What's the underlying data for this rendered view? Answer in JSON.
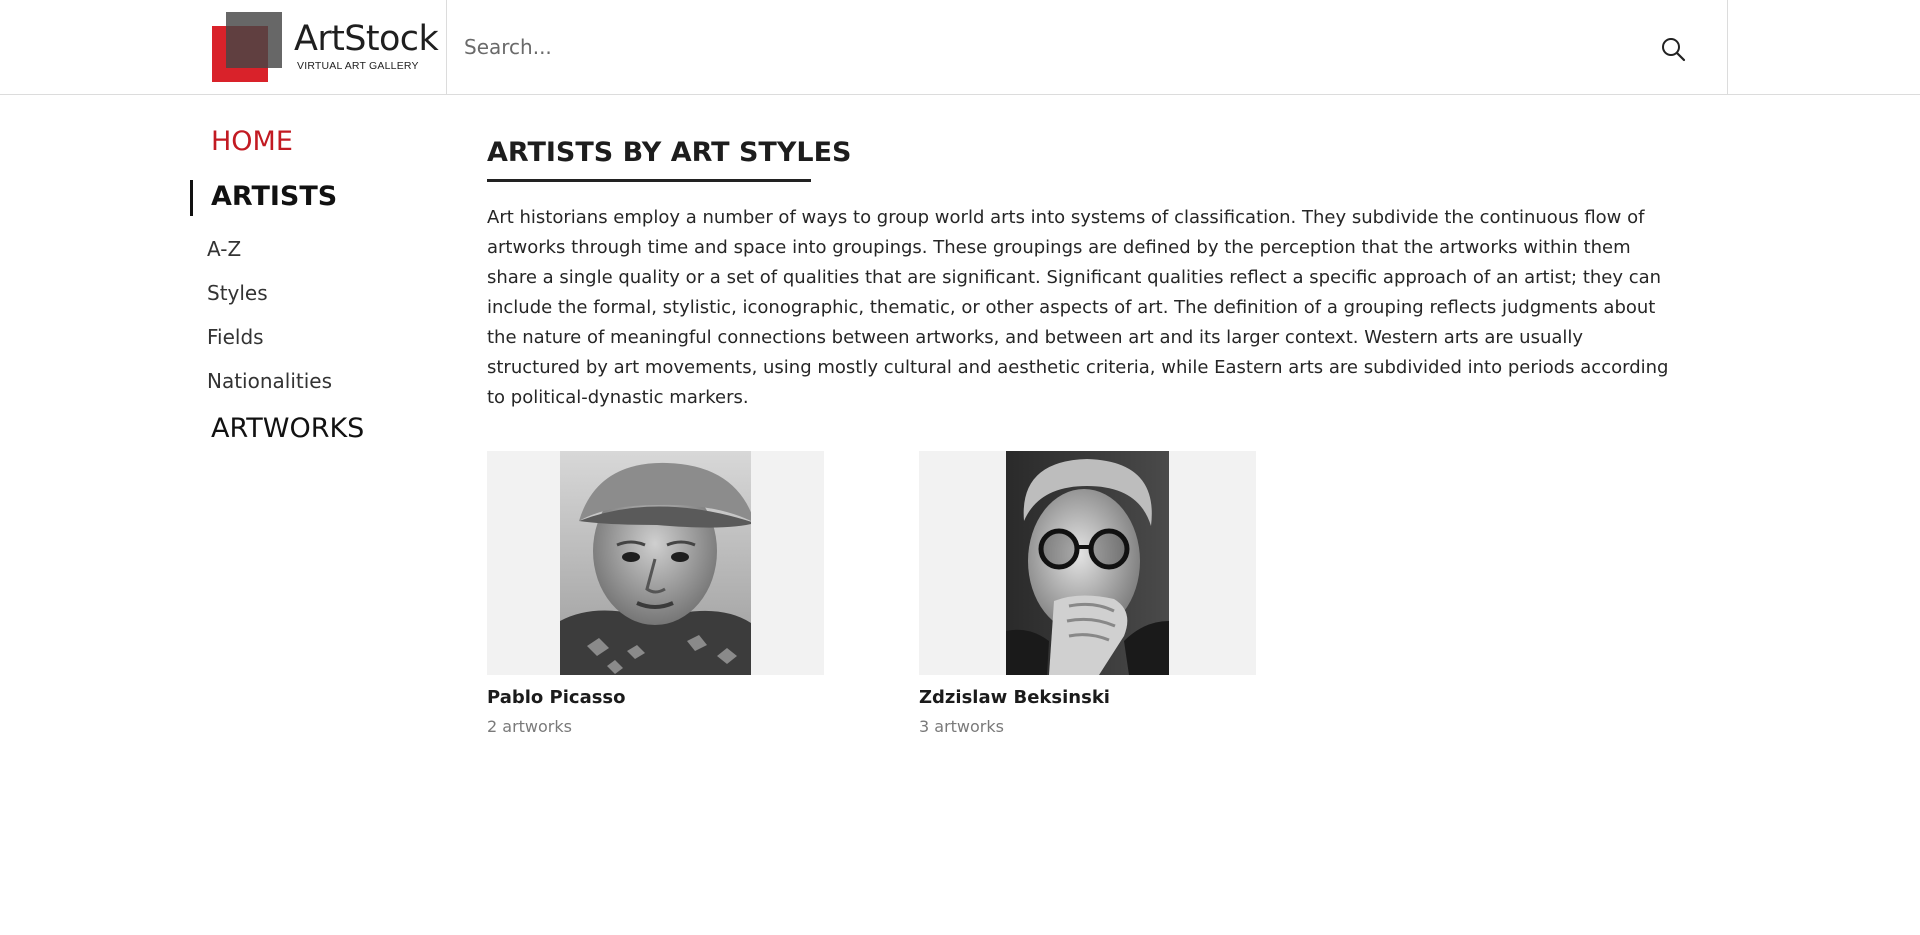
{
  "header": {
    "logo": {
      "name": "ArtStock",
      "tagline": "VIRTUAL ART GALLERY",
      "colors": {
        "red": "#d9222a",
        "gray": "#464646"
      }
    },
    "search": {
      "placeholder": "Search...",
      "value": "",
      "icon": "search-icon"
    }
  },
  "sidebar": {
    "home_label": "HOME",
    "artists_label": "ARTISTS",
    "artists_sub": [
      "A-Z",
      "Styles",
      "Fields",
      "Nationalities"
    ],
    "artworks_label": "ARTWORKS",
    "active_item": "ARTISTS",
    "accent_color": "#c21a22"
  },
  "main": {
    "title": "ARTISTS BY ART STYLES",
    "intro": "Art historians employ a number of ways to group world arts into systems of classification. They subdivide the continuous flow of artworks through time and space into groupings. These groupings are defined by the perception that the artworks within them share a single quality or a set of qualities that are significant. Significant qualities reflect a specific approach of an artist; they can include the formal, stylistic, iconographic, thematic, or other aspects of art. The definition of a grouping reflects judgments about the nature of meaningful connections between artworks, and between art and its larger context. Western arts are usually structured by art movements, using mostly cultural and aesthetic criteria, while Eastern arts are subdivided into periods according to political-dynastic markers.",
    "artists": [
      {
        "name": "Pablo Picasso",
        "count": "2 artworks"
      },
      {
        "name": "Zdzislaw Beksinski",
        "count": "3 artworks"
      }
    ]
  }
}
